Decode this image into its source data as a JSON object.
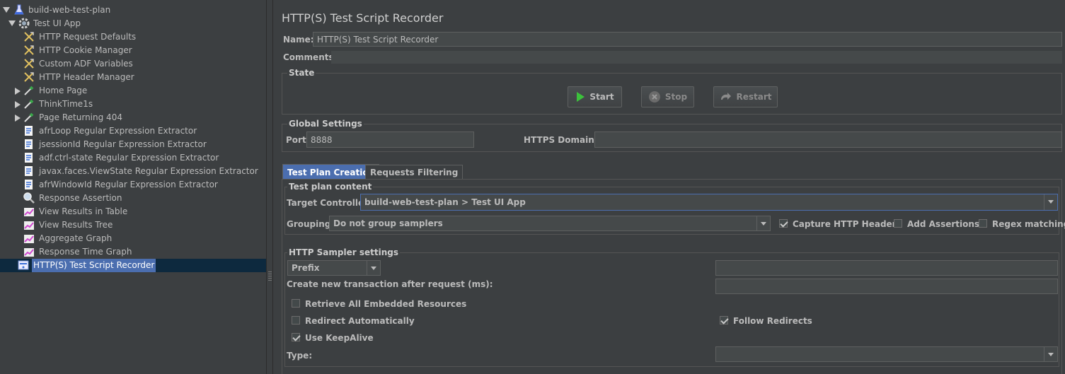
{
  "tree": {
    "nodes": [
      {
        "label": "build-web-test-plan",
        "icon": "flask-icon"
      },
      {
        "label": "Test UI App",
        "icon": "gear-icon"
      },
      {
        "label": "HTTP Request Defaults",
        "icon": "wrench-icon"
      },
      {
        "label": "HTTP Cookie Manager",
        "icon": "wrench-icon"
      },
      {
        "label": "Custom ADF Variables",
        "icon": "wrench-icon"
      },
      {
        "label": "HTTP Header Manager",
        "icon": "wrench-icon"
      },
      {
        "label": "Home Page",
        "icon": "pipette-icon"
      },
      {
        "label": "ThinkTime1s",
        "icon": "pipette-icon"
      },
      {
        "label": "Page Returning 404",
        "icon": "pipette-icon"
      },
      {
        "label": "afrLoop Regular Expression Extractor",
        "icon": "document-icon"
      },
      {
        "label": "jsessionId Regular Expression Extractor",
        "icon": "document-icon"
      },
      {
        "label": "adf.ctrl-state Regular Expression Extractor",
        "icon": "document-icon"
      },
      {
        "label": "javax.faces.ViewState Regular Expression Extractor",
        "icon": "document-icon"
      },
      {
        "label": "afrWindowId Regular Expression Extractor",
        "icon": "document-icon"
      },
      {
        "label": "Response Assertion",
        "icon": "magnifier-icon"
      },
      {
        "label": "View Results in Table",
        "icon": "graph-icon"
      },
      {
        "label": "View Results Tree",
        "icon": "graph-icon"
      },
      {
        "label": "Aggregate Graph",
        "icon": "graph-icon"
      },
      {
        "label": "Response Time Graph",
        "icon": "graph-icon"
      },
      {
        "label": "HTTP(S) Test Script Recorder",
        "icon": "recorder-icon"
      }
    ]
  },
  "panel": {
    "title": "HTTP(S) Test Script Recorder",
    "name_label": "Name:",
    "name_value": "HTTP(S) Test Script Recorder",
    "comments_label": "Comments:",
    "comments_value": "",
    "state": {
      "title": "State",
      "start": "Start",
      "stop": "Stop",
      "restart": "Restart"
    },
    "global": {
      "title": "Global Settings",
      "port_label": "Port:",
      "port_value": "8888",
      "https_label": "HTTPS Domains:",
      "https_value": ""
    },
    "tabs": [
      "Test Plan Creation",
      "Requests Filtering"
    ],
    "content": {
      "title": "Test plan content",
      "target_label": "Target Controller:",
      "target_value": "build-web-test-plan > Test UI App",
      "grouping_label": "Grouping:",
      "grouping_value": "Do not group samplers",
      "capture_headers": "Capture HTTP Headers",
      "add_assertions": "Add Assertions",
      "regex_matching": "Regex matching"
    },
    "sampler": {
      "title": "HTTP Sampler settings",
      "prefix_value": "Prefix",
      "prefix_input": "",
      "transaction_label": "Create new transaction after request (ms):",
      "transaction_value": "",
      "retrieve_embedded": "Retrieve All Embedded Resources",
      "redirect_auto": "Redirect Automatically",
      "follow_redirects": "Follow Redirects",
      "keepalive": "Use KeepAlive",
      "type_label": "Type:",
      "type_value": ""
    }
  },
  "colors": {
    "background": "#3c3f41",
    "selection": "#4b6eaf",
    "selected_row": "#0d293e"
  }
}
